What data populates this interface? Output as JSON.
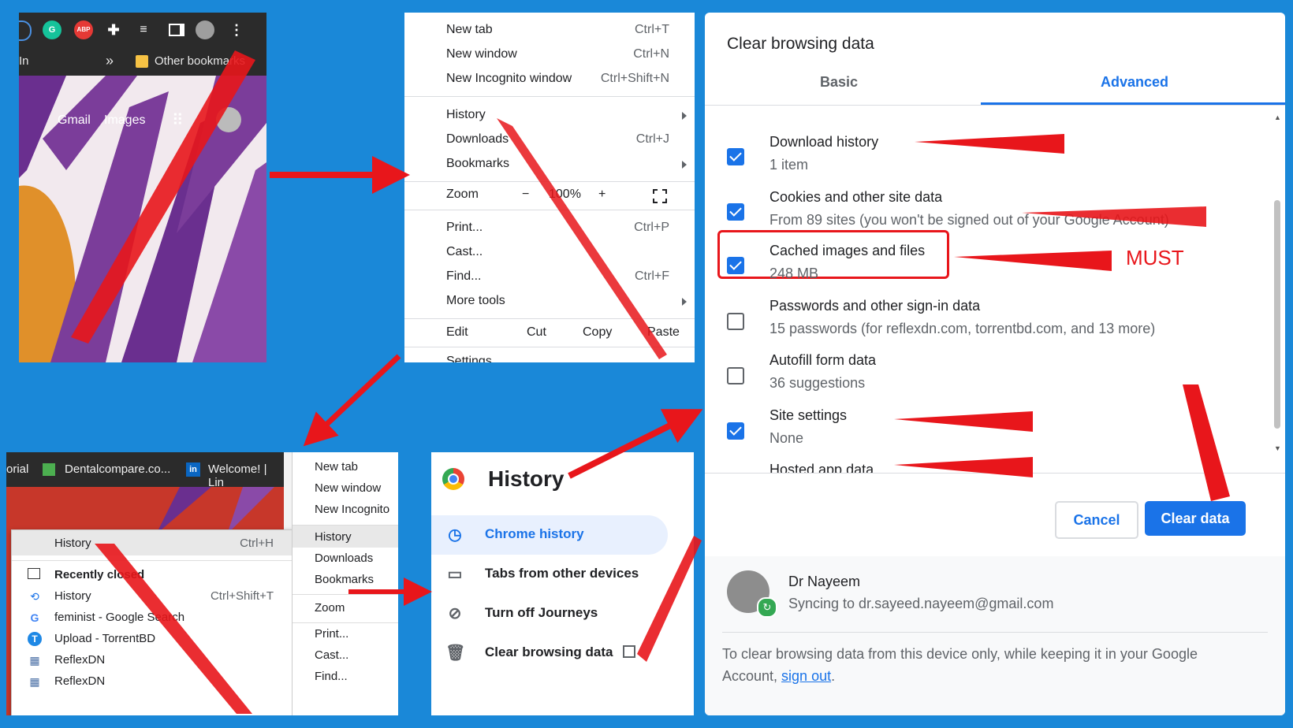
{
  "panel_toolbar": {
    "toolbar_icons": [
      "grammarly-icon",
      "adblock-icon",
      "extensions-icon",
      "media-icon",
      "sidepanel-icon",
      "profile-icon",
      "more-menu-icon"
    ],
    "abp_label": "ABP",
    "bookmarks_left": "In",
    "bookmarks_chevron": "»",
    "other_bookmarks": "Other bookmarks",
    "gmail": "Gmail",
    "images": "Images"
  },
  "chrome_menu": {
    "items": [
      {
        "label": "New tab",
        "key": "Ctrl+T"
      },
      {
        "label": "New window",
        "key": "Ctrl+N"
      },
      {
        "label": "New Incognito window",
        "key": "Ctrl+Shift+N"
      },
      {
        "label": "History",
        "key": ""
      },
      {
        "label": "Downloads",
        "key": "Ctrl+J"
      },
      {
        "label": "Bookmarks",
        "key": ""
      },
      {
        "label": "Print...",
        "key": "Ctrl+P"
      },
      {
        "label": "Cast...",
        "key": ""
      },
      {
        "label": "Find...",
        "key": "Ctrl+F"
      },
      {
        "label": "More tools",
        "key": ""
      }
    ],
    "zoom_label": "Zoom",
    "zoom_minus": "−",
    "zoom_value": "100%",
    "zoom_plus": "+",
    "edit_label": "Edit",
    "cut": "Cut",
    "copy": "Copy",
    "paste": "Paste",
    "settings": "Settings"
  },
  "history_submenu": {
    "tabs": [
      {
        "label": "orial"
      },
      {
        "label": "Dentalcompare.co..."
      },
      {
        "label": "Welcome! | Lin"
      }
    ],
    "items": [
      {
        "label": "History",
        "key": "Ctrl+H",
        "icon": ""
      },
      {
        "label": "Recently closed",
        "key": "",
        "icon": "window-icon"
      },
      {
        "label": "History",
        "key": "Ctrl+Shift+T",
        "icon": "history-icon"
      },
      {
        "label": "feminist - Google Search",
        "key": "",
        "icon": "google-icon"
      },
      {
        "label": "Upload - TorrentBD",
        "key": "",
        "icon": "torrentbd-icon"
      },
      {
        "label": "ReflexDN",
        "key": "",
        "icon": "reflexdn-icon"
      },
      {
        "label": "ReflexDN",
        "key": "",
        "icon": "reflexdn-icon"
      }
    ],
    "right_menu": [
      "New tab",
      "New window",
      "New Incognito",
      "History",
      "Downloads",
      "Bookmarks",
      "Zoom",
      "Print...",
      "Cast...",
      "Find..."
    ]
  },
  "history_page": {
    "title": "History",
    "nav": [
      {
        "label": "Chrome history",
        "icon": "clock-icon",
        "active": true
      },
      {
        "label": "Tabs from other devices",
        "icon": "devices-icon",
        "active": false
      },
      {
        "label": "Turn off Journeys",
        "icon": "journeys-off-icon",
        "active": false
      },
      {
        "label": "Clear browsing data",
        "icon": "trash-icon",
        "active": false
      }
    ]
  },
  "clear_dialog": {
    "title": "Clear browsing data",
    "tab_basic": "Basic",
    "tab_advanced": "Advanced",
    "items": [
      {
        "title": "Download history",
        "sub": "1 item",
        "checked": true
      },
      {
        "title": "Cookies and other site data",
        "sub": "From 89 sites (you won't be signed out of your Google Account)",
        "checked": true
      },
      {
        "title": "Cached images and files",
        "sub": "248 MB",
        "checked": true
      },
      {
        "title": "Passwords and other sign-in data",
        "sub": "15 passwords (for reflexdn.com, torrentbd.com, and 13 more)",
        "checked": false
      },
      {
        "title": "Autofill form data",
        "sub": "36 suggestions",
        "checked": false
      },
      {
        "title": "Site settings",
        "sub": "None",
        "checked": true
      },
      {
        "title": "Hosted app data",
        "sub": "",
        "checked": true
      }
    ],
    "must_label": "MUST",
    "cancel": "Cancel",
    "clear": "Clear data",
    "user_name": "Dr Nayeem",
    "sync_text": "Syncing to dr.sayeed.nayeem@gmail.com",
    "footer_text": "To clear browsing data from this device only, while keeping it in your Google Account, ",
    "footer_link": "sign out",
    "footer_end": ".",
    "accent": "#1a73e8",
    "annotation_red": "#e8161b"
  }
}
